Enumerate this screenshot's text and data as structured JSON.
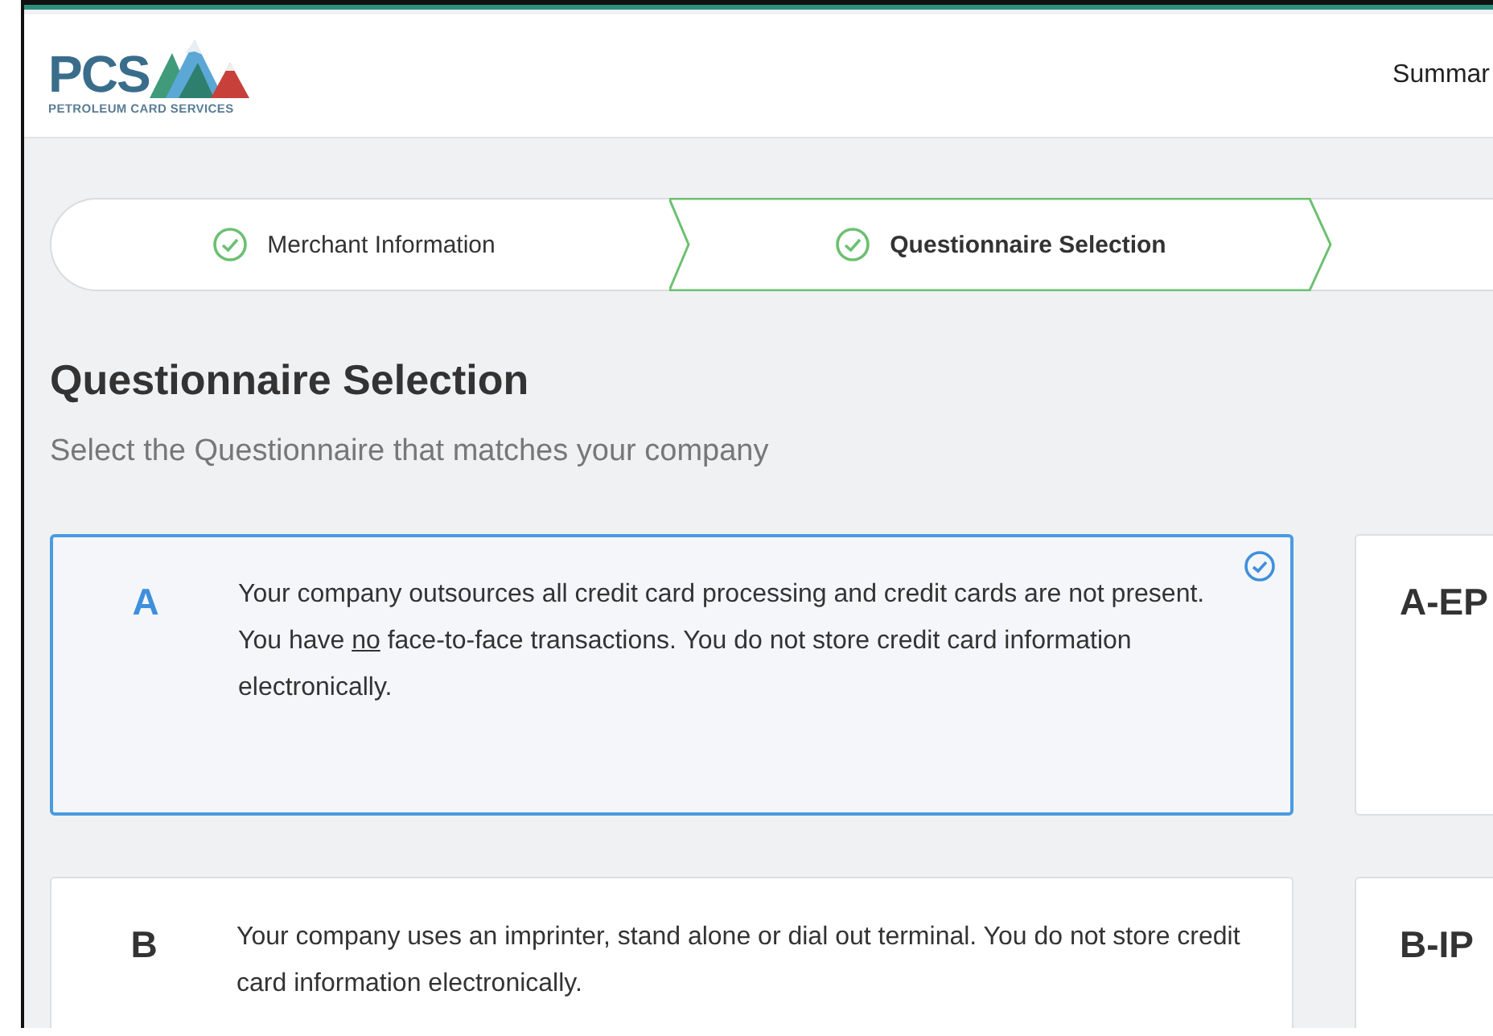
{
  "header": {
    "logo": {
      "initials": "PCS",
      "tagline": "PETROLEUM CARD SERVICES"
    },
    "nav_link": "Summar"
  },
  "steps": [
    {
      "label": "Merchant Information",
      "completed": true,
      "selected": false
    },
    {
      "label": "Questionnaire Selection",
      "completed": true,
      "selected": true
    }
  ],
  "heading": "Questionnaire Selection",
  "subheading": "Select the Questionnaire that matches your company",
  "cards": [
    {
      "letter": "A",
      "selected": true,
      "description": [
        {
          "text": "Your company outsources all credit card processing and credit cards are not present. You have ",
          "underline": false
        },
        {
          "text": "no",
          "underline": true
        },
        {
          "text": " face-to-face transactions. You do not store credit card information electronically.",
          "underline": false
        }
      ]
    },
    {
      "letter": "A-EP",
      "selected": false
    },
    {
      "letter": "B",
      "selected": false,
      "description": [
        {
          "text": "Your company uses an imprinter, stand alone or dial out terminal. You do not store credit card information electronically.",
          "underline": false
        }
      ]
    },
    {
      "letter": "B-IP",
      "selected": false
    }
  ]
}
